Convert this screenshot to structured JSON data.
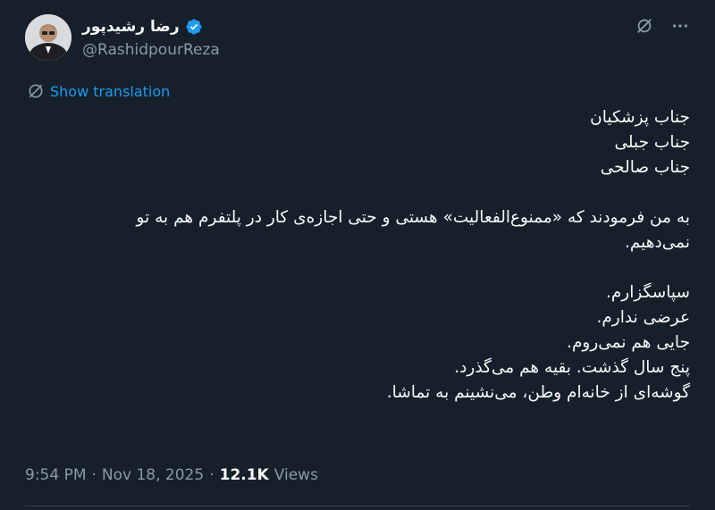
{
  "author": {
    "display_name": "رضا رشیدپور",
    "handle": "@RashidpourReza",
    "avatar_icon": "profile-photo",
    "verified_icon": "verified-badge-icon"
  },
  "header_icons": [
    "grok-icon",
    "more-icon"
  ],
  "translation": {
    "label": "Show translation",
    "icon": "globe-icon"
  },
  "tweet_lines": {
    "p1_line1": "جناب پزشکیان",
    "p1_line2": "جناب جبلی",
    "p1_line3": "جناب صالحی",
    "p2_line1": "به من فرمودند که «ممنوع‌الفعالیت» هستی و حتی اجازه‌ی کار در پلتفرم هم به تو",
    "p2_line2": "نمی‌دهیم.",
    "p3_line1": "سپاسگزارم.",
    "p3_line2": "عرضی ندارم.",
    "p3_line3": "جایی هم نمی‌روم.",
    "p3_line4": "پنج سال گذشت. بقیه هم می‌گذرد.",
    "p3_line5": "گوشه‌ای از خانه‌ام وطن، می‌نشینم به تماشا."
  },
  "meta": {
    "time": "9:54 PM",
    "separator": "·",
    "date": "Nov 18, 2025",
    "views_count": "12.1K",
    "views_label": "Views"
  },
  "colors": {
    "background": "#15202b",
    "text": "#f7f9f9",
    "secondary": "#8b98a5",
    "accent": "#1d9bf0"
  }
}
